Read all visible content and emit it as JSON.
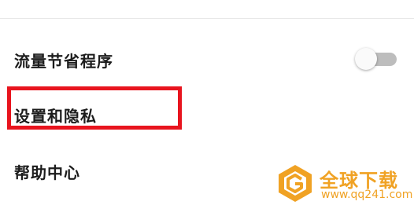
{
  "settings": {
    "items": [
      {
        "label": "流量节省程序",
        "toggle_on": false
      },
      {
        "label": "设置和隐私"
      },
      {
        "label": "帮助中心"
      }
    ]
  },
  "annotation": {
    "highlight_color": "#e8141e",
    "highlighted_item": "设置和隐私"
  },
  "watermark": {
    "title": "全球下载",
    "url": "www.qq241.com",
    "color": "#f0a224"
  }
}
